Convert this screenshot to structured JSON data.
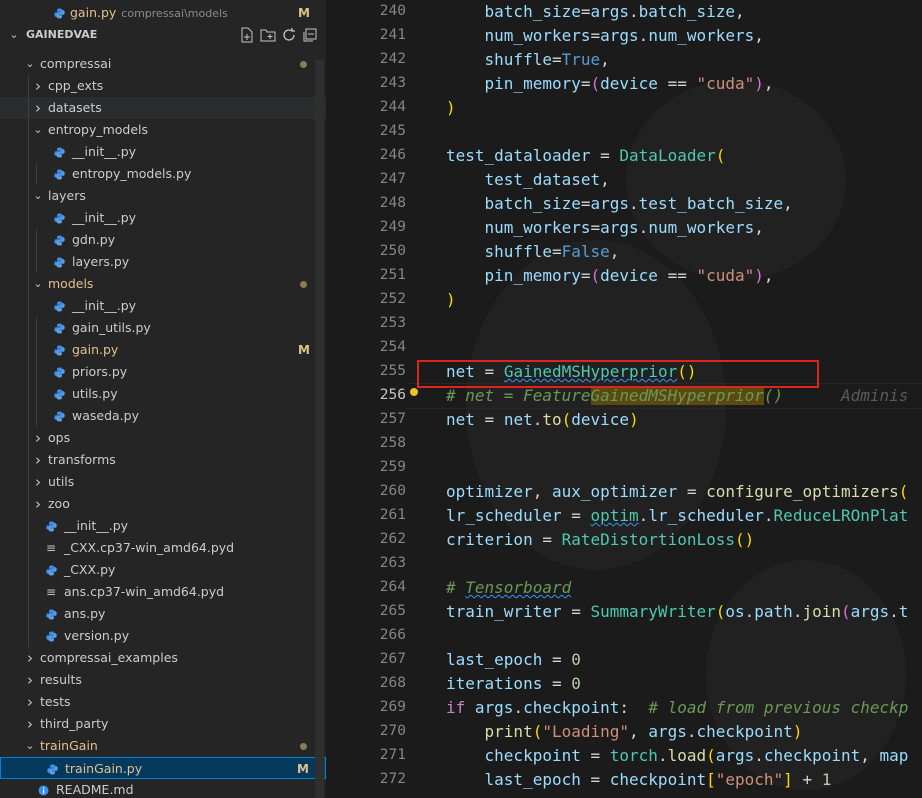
{
  "explorer": {
    "open_editor": {
      "name": "gain.py",
      "path": "compressai\\models",
      "badge": "M"
    },
    "root": "GAINEDVAE",
    "items": [
      {
        "label": "compressai",
        "type": "folder-open",
        "indent": 0,
        "dot": true
      },
      {
        "label": "cpp_exts",
        "type": "folder",
        "indent": 1
      },
      {
        "label": "datasets",
        "type": "folder",
        "indent": 1
      },
      {
        "label": "entropy_models",
        "type": "folder-open",
        "indent": 1
      },
      {
        "label": "__init__.py",
        "type": "py",
        "indent": 2
      },
      {
        "label": "entropy_models.py",
        "type": "py",
        "indent": 2
      },
      {
        "label": "layers",
        "type": "folder-open",
        "indent": 1
      },
      {
        "label": "__init__.py",
        "type": "py",
        "indent": 2
      },
      {
        "label": "gdn.py",
        "type": "py",
        "indent": 2
      },
      {
        "label": "layers.py",
        "type": "py",
        "indent": 2
      },
      {
        "label": "models",
        "type": "folder-open",
        "indent": 1,
        "dot": true,
        "modified": true
      },
      {
        "label": "__init__.py",
        "type": "py",
        "indent": 2
      },
      {
        "label": "gain_utils.py",
        "type": "py",
        "indent": 2
      },
      {
        "label": "gain.py",
        "type": "py",
        "indent": 2,
        "modified": true,
        "badge": "M"
      },
      {
        "label": "priors.py",
        "type": "py",
        "indent": 2
      },
      {
        "label": "utils.py",
        "type": "py",
        "indent": 2
      },
      {
        "label": "waseda.py",
        "type": "py",
        "indent": 2
      },
      {
        "label": "ops",
        "type": "folder",
        "indent": 1
      },
      {
        "label": "transforms",
        "type": "folder",
        "indent": 1
      },
      {
        "label": "utils",
        "type": "folder",
        "indent": 1
      },
      {
        "label": "zoo",
        "type": "folder",
        "indent": 1
      },
      {
        "label": "__init__.py",
        "type": "py",
        "indent": 1
      },
      {
        "label": "_CXX.cp37-win_amd64.pyd",
        "type": "lines",
        "indent": 1
      },
      {
        "label": "_CXX.py",
        "type": "py",
        "indent": 1
      },
      {
        "label": "ans.cp37-win_amd64.pyd",
        "type": "lines",
        "indent": 1
      },
      {
        "label": "ans.py",
        "type": "py",
        "indent": 1
      },
      {
        "label": "version.py",
        "type": "py",
        "indent": 1
      },
      {
        "label": "compressai_examples",
        "type": "folder",
        "indent": 0
      },
      {
        "label": "results",
        "type": "folder",
        "indent": 0
      },
      {
        "label": "tests",
        "type": "folder",
        "indent": 0
      },
      {
        "label": "third_party",
        "type": "folder",
        "indent": 0
      },
      {
        "label": "trainGain",
        "type": "folder-open",
        "indent": 0,
        "dot": true,
        "modified": true
      },
      {
        "label": "trainGain.py",
        "type": "py",
        "indent": 1,
        "modified": true,
        "badge": "M",
        "selected": true
      },
      {
        "label": "README.md",
        "type": "info",
        "indent": 0
      }
    ]
  },
  "editor": {
    "active_line": 256,
    "lines": [
      {
        "n": 240,
        "html": "        <span class='var'>batch_size</span>=<span class='var'>args</span>.<span class='var'>batch_size</span>,"
      },
      {
        "n": 241,
        "html": "        <span class='var'>num_workers</span>=<span class='var'>args</span>.<span class='var'>num_workers</span>,"
      },
      {
        "n": 242,
        "html": "        <span class='var'>shuffle</span>=<span class='kw'>True</span>,"
      },
      {
        "n": 243,
        "html": "        <span class='var'>pin_memory</span>=<span class='paren2'>(</span><span class='var'>device</span> == <span class='str'>\"cuda\"</span><span class='paren2'>)</span>,"
      },
      {
        "n": 244,
        "html": "    <span class='paren'>)</span>"
      },
      {
        "n": 245,
        "html": ""
      },
      {
        "n": 246,
        "html": "    <span class='var'>test_dataloader</span> = <span class='cls'>DataLoader</span><span class='paren'>(</span>"
      },
      {
        "n": 247,
        "html": "        <span class='var'>test_dataset</span>,"
      },
      {
        "n": 248,
        "html": "        <span class='var'>batch_size</span>=<span class='var'>args</span>.<span class='var'>test_batch_size</span>,"
      },
      {
        "n": 249,
        "html": "        <span class='var'>num_workers</span>=<span class='var'>args</span>.<span class='var'>num_workers</span>,"
      },
      {
        "n": 250,
        "html": "        <span class='var'>shuffle</span>=<span class='kw'>False</span>,"
      },
      {
        "n": 251,
        "html": "        <span class='var'>pin_memory</span>=<span class='paren2'>(</span><span class='var'>device</span> == <span class='str'>\"cuda\"</span><span class='paren2'>)</span>,"
      },
      {
        "n": 252,
        "html": "    <span class='paren'>)</span>"
      },
      {
        "n": 253,
        "html": ""
      },
      {
        "n": 254,
        "html": ""
      },
      {
        "n": 255,
        "html": "    <span class='var'>net</span> = <span class='cls sq'>GainedMSHyperprior</span><span class='paren'>()</span>"
      },
      {
        "n": 256,
        "html": "    <span class='cmt'># net = Feature<span class='hl'>GainedMSHyperprior</span>()</span>      <span class='blame'>Adminis</span>"
      },
      {
        "n": 257,
        "html": "    <span class='var'>net</span> = <span class='var'>net</span>.<span class='fn'>to</span><span class='paren'>(</span><span class='var'>device</span><span class='paren'>)</span>"
      },
      {
        "n": 258,
        "html": ""
      },
      {
        "n": 259,
        "html": ""
      },
      {
        "n": 260,
        "html": "    <span class='var'>optimizer</span>, <span class='var'>aux_optimizer</span> = <span class='fn'>configure_optimizers</span><span class='paren'>(</span>"
      },
      {
        "n": 261,
        "html": "    <span class='var'>lr_scheduler</span> = <span class='cls sq'>optim</span>.<span class='var'>lr_scheduler</span>.<span class='cls'>ReduceLROnPlat</span>"
      },
      {
        "n": 262,
        "html": "    <span class='var'>criterion</span> = <span class='cls'>RateDistortionLoss</span><span class='paren'>()</span>"
      },
      {
        "n": 263,
        "html": ""
      },
      {
        "n": 264,
        "html": "    <span class='cmt'># <span class='sq'>Tensorboard</span></span>"
      },
      {
        "n": 265,
        "html": "    <span class='var'>train_writer</span> = <span class='cls'>SummaryWriter</span><span class='paren'>(</span><span class='var'>os</span>.<span class='var'>path</span>.<span class='fn'>join</span><span class='paren2'>(</span><span class='var'>args</span>.<span class='var'>t</span>"
      },
      {
        "n": 266,
        "html": ""
      },
      {
        "n": 267,
        "html": "    <span class='var'>last_epoch</span> = <span class='num'>0</span>"
      },
      {
        "n": 268,
        "html": "    <span class='var'>iterations</span> = <span class='num'>0</span>"
      },
      {
        "n": 269,
        "html": "    <span class='kw2'>if</span> <span class='var'>args</span>.<span class='var'>checkpoint</span>:  <span class='cmt'># load from previous checkp</span>"
      },
      {
        "n": 270,
        "html": "        <span class='fn'>print</span><span class='paren'>(</span><span class='str'>\"Loading\"</span>, <span class='var'>args</span>.<span class='var'>checkpoint</span><span class='paren'>)</span>"
      },
      {
        "n": 271,
        "html": "        <span class='var'>checkpoint</span> = <span class='cls'>torch</span>.<span class='fn'>load</span><span class='paren'>(</span><span class='var'>args</span>.<span class='var'>checkpoint</span>, <span class='var'>map</span>"
      },
      {
        "n": 272,
        "html": "        <span class='var'>last_epoch</span> = <span class='var'>checkpoint</span><span class='paren'>[</span><span class='str'>\"epoch\"</span><span class='paren'>]</span> + <span class='num'>1</span>"
      }
    ]
  },
  "colors": {
    "accent": "#007fd4",
    "modified": "#e2c08d",
    "annotation": "#e0231d"
  },
  "icons": {
    "py": "python-file-icon",
    "folder": "chevron-right-icon",
    "folder-open": "chevron-down-icon",
    "lines": "text-file-icon",
    "info": "info-file-icon"
  }
}
